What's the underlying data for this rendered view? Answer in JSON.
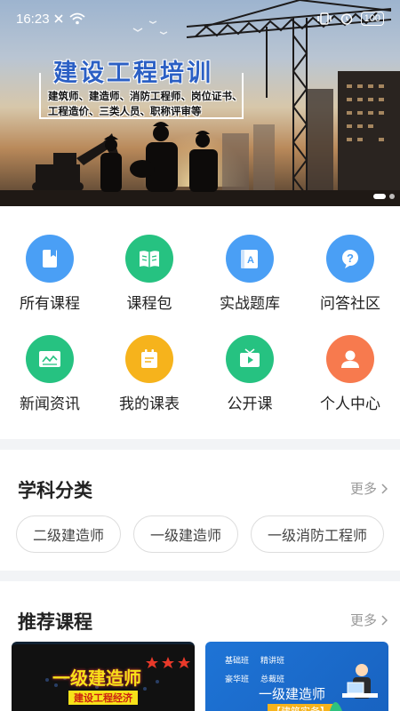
{
  "status_bar": {
    "time": "16:23",
    "battery": "100"
  },
  "banner": {
    "title": "建设工程培训",
    "subtitle_line1": "建筑师、建造师、消防工程师、岗位证书、",
    "subtitle_line2": "工程造价、三类人员、职称评审等"
  },
  "grid": {
    "items": [
      {
        "label": "所有课程",
        "icon": "book-icon",
        "color": "#4a9ff5"
      },
      {
        "label": "课程包",
        "icon": "open-book-icon",
        "color": "#26c281"
      },
      {
        "label": "实战题库",
        "icon": "question-bank-icon",
        "color": "#4a9ff5"
      },
      {
        "label": "问答社区",
        "icon": "question-bubble-icon",
        "color": "#4a9ff5"
      },
      {
        "label": "新闻资讯",
        "icon": "news-icon",
        "color": "#26c281"
      },
      {
        "label": "我的课表",
        "icon": "schedule-icon",
        "color": "#f6b31c"
      },
      {
        "label": "公开课",
        "icon": "play-tv-icon",
        "color": "#26c281"
      },
      {
        "label": "个人中心",
        "icon": "user-icon",
        "color": "#f77a4e"
      }
    ]
  },
  "categories": {
    "title": "学科分类",
    "more": "更多",
    "chips": [
      "二级建造师",
      "一级建造师",
      "一级消防工程师"
    ]
  },
  "recommended": {
    "title": "推荐课程",
    "more": "更多",
    "course1": {
      "title": "一级建造师",
      "subtitle": "建设工程经济"
    },
    "course2": {
      "title": "一级建造师",
      "tags": [
        "基础班",
        "精讲班",
        "豪华班",
        "总裁班"
      ],
      "subtitle": "【建筑实务】"
    }
  }
}
